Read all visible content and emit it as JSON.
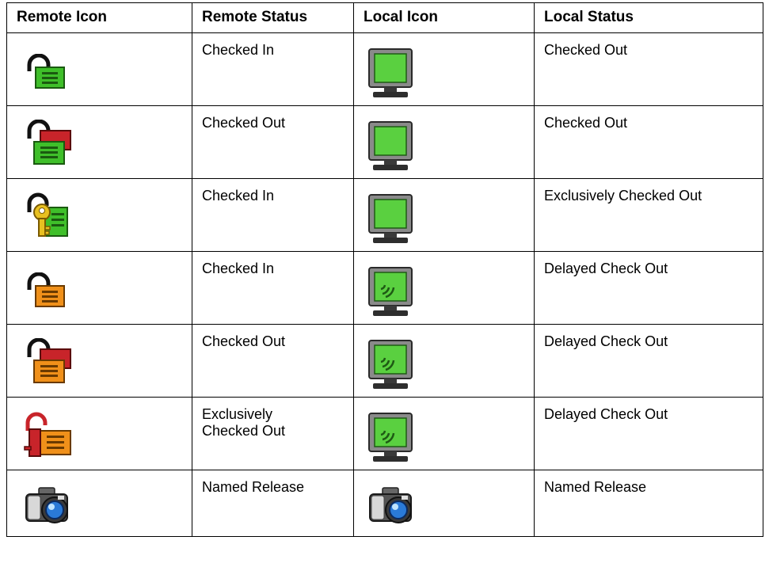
{
  "headers": [
    "Remote Icon",
    "Remote Status",
    "Local Icon",
    "Local Status"
  ],
  "rows": [
    {
      "remote_icon": "open-padlock-green-icon",
      "remote_status": "Checked In",
      "local_icon": "green-monitor-icon",
      "local_status": "Checked Out"
    },
    {
      "remote_icon": "open-padlock-red-green-icon",
      "remote_status": "Checked Out",
      "local_icon": "green-monitor-icon",
      "local_status": "Checked Out"
    },
    {
      "remote_icon": "key-padlock-green-icon",
      "remote_status": "Checked In",
      "local_icon": "green-monitor-icon",
      "local_status": " Exclusively Checked Out"
    },
    {
      "remote_icon": "open-padlock-orange-icon",
      "remote_status": "Checked In",
      "local_icon": "green-monitor-signal-icon",
      "local_status": " Delayed Check Out"
    },
    {
      "remote_icon": "open-padlock-red-orange-icon",
      "remote_status": "Checked Out",
      "local_icon": "green-monitor-signal-icon",
      "local_status": "Delayed Check Out"
    },
    {
      "remote_icon": "key-padlock-orange-icon",
      "remote_status": " Exclusively\nChecked Out",
      "local_icon": "green-monitor-signal-icon",
      "local_status": "Delayed Check Out"
    },
    {
      "remote_icon": "camera-icon",
      "remote_status": "Named Release",
      "local_icon": "camera-icon",
      "local_status": "Named Release"
    }
  ],
  "colors": {
    "green": "#3fbf2a",
    "orange": "#f0901a",
    "red": "#c8242a",
    "key_yellow": "#e8c020",
    "monitor_gray": "#8a8a8a",
    "screen_green": "#5ad040"
  }
}
